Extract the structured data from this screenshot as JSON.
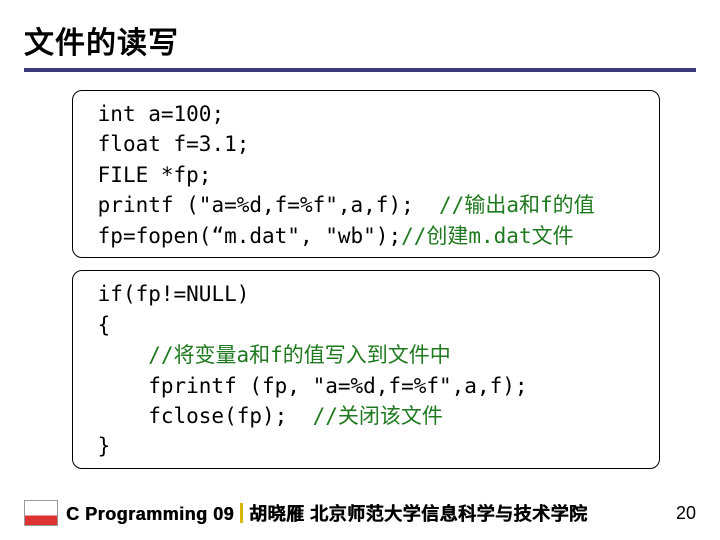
{
  "title": "文件的读写",
  "code1": {
    "l1": " int a=100;",
    "l2": " float f=3.1;",
    "l3": " FILE *fp;",
    "l4a": " printf (\"a=%d,f=%f\",a,f);  ",
    "l4c": "//输出a和f的值",
    "l5a": " fp=fopen(“m.dat\", \"wb\");",
    "l5c": "//创建m.dat文件"
  },
  "code2": {
    "l1": " if(fp!=NULL)",
    "l2": " {",
    "l3c": "     //将变量a和f的值写入到文件中",
    "l4": "     fprintf (fp, \"a=%d,f=%f\",a,f);",
    "l5a": "     fclose(fp);  ",
    "l5c": "//关闭该文件",
    "l6": " }"
  },
  "footer": {
    "course": "C Programming 09",
    "author": "胡晓雁 北京师范大学信息科学与技术学院"
  },
  "page": "20"
}
